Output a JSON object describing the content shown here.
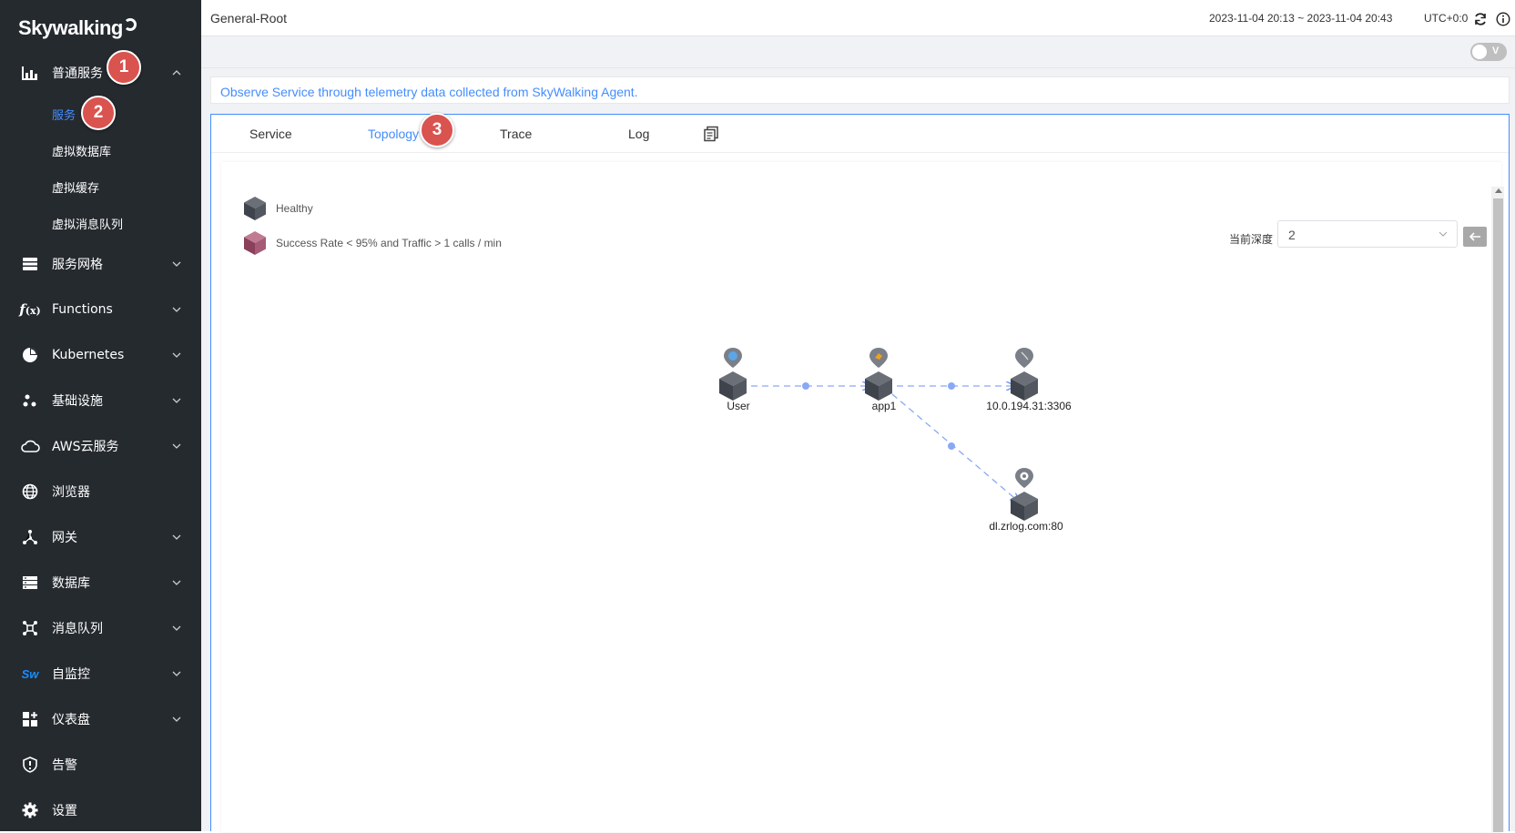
{
  "app": {
    "logo_text": "Skywalking"
  },
  "sidebar": {
    "items": [
      {
        "label": "普通服务",
        "icon": "bar-chart-icon",
        "expanded": true,
        "children": [
          {
            "label": "服务",
            "active": true
          },
          {
            "label": "虚拟数据库"
          },
          {
            "label": "虚拟缓存"
          },
          {
            "label": "虚拟消息队列"
          }
        ]
      },
      {
        "label": "服务网格",
        "icon": "layers-icon"
      },
      {
        "label": "Functions",
        "icon": "function-icon"
      },
      {
        "label": "Kubernetes",
        "icon": "pie-chart-icon"
      },
      {
        "label": "基础设施",
        "icon": "dots-icon"
      },
      {
        "label": "AWS云服务",
        "icon": "cloud-icon"
      },
      {
        "label": "浏览器",
        "icon": "globe-icon"
      },
      {
        "label": "网关",
        "icon": "gateway-icon"
      },
      {
        "label": "数据库",
        "icon": "database-icon"
      },
      {
        "label": "消息队列",
        "icon": "network-icon"
      },
      {
        "label": "自监控",
        "icon": "sw-icon"
      },
      {
        "label": "仪表盘",
        "icon": "dashboard-icon"
      },
      {
        "label": "告警",
        "icon": "alert-icon"
      },
      {
        "label": "设置",
        "icon": "gear-icon"
      }
    ]
  },
  "annotations": {
    "step1": "1",
    "step2": "2",
    "step3": "3"
  },
  "header": {
    "title": "General-Root",
    "time_range": "2023-11-04 20:13 ~ 2023-11-04 20:43",
    "timezone": "UTC+0:0",
    "toggle_label": "V"
  },
  "notice": "Observe Service through telemetry data collected from SkyWalking Agent.",
  "tabs": [
    {
      "label": "Service",
      "active": false
    },
    {
      "label": "Topology",
      "active": true
    },
    {
      "label": "Trace",
      "active": false
    },
    {
      "label": "Log",
      "active": false
    }
  ],
  "topology": {
    "legend": [
      {
        "label": "Healthy",
        "color": "#4a4f57"
      },
      {
        "label": "Success Rate < 95% and Traffic > 1 calls / min",
        "color": "#9a4f6a"
      }
    ],
    "depth_label": "当前深度",
    "depth_value": "2",
    "nodes": [
      {
        "label": "User",
        "icon": "user-icon"
      },
      {
        "label": "app1",
        "icon": "tomcat-icon"
      },
      {
        "label": "10.0.194.31:3306",
        "icon": "mysql-icon"
      },
      {
        "label": "dl.zrlog.com:80",
        "icon": "http-icon"
      }
    ],
    "edges": [
      {
        "from": "User",
        "to": "app1"
      },
      {
        "from": "app1",
        "to": "10.0.194.31:3306"
      },
      {
        "from": "app1",
        "to": "dl.zrlog.com:80"
      }
    ]
  },
  "colors": {
    "sidebar_bg": "#252a2f",
    "accent": "#448dfe",
    "badge": "#d9534f"
  }
}
